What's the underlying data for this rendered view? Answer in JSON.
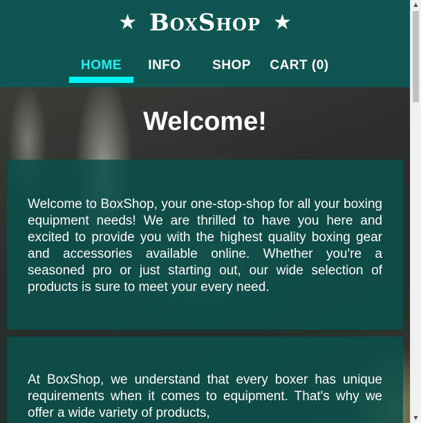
{
  "header": {
    "star_left": "★",
    "logo": "BoxShop",
    "star_right": "★"
  },
  "nav": {
    "items": [
      {
        "label": "HOME",
        "active": true
      },
      {
        "label": "INFO",
        "active": false
      },
      {
        "label": "SHOP",
        "active": false
      },
      {
        "label": "CART (0)",
        "active": false
      }
    ]
  },
  "main": {
    "title": "Welcome!",
    "paragraphs": [
      "Welcome to BoxShop, your one-stop-shop for all your boxing equipment needs! We are thrilled to have you here and excited to provide you with the highest quality boxing gear and accessories available online. Whether you're a seasoned pro or just starting out, our wide selection of products is sure to meet your every need.",
      "At BoxShop, we understand that every boxer has unique requirements when it comes to equipment. That's why we offer a wide variety of products,"
    ]
  },
  "colors": {
    "header_bg": "#0f5552",
    "nav_active": "#1ef0ee",
    "card_bg": "#0a504c"
  },
  "scrollbar": {
    "up_icon": "▲",
    "down_icon": "▼"
  }
}
